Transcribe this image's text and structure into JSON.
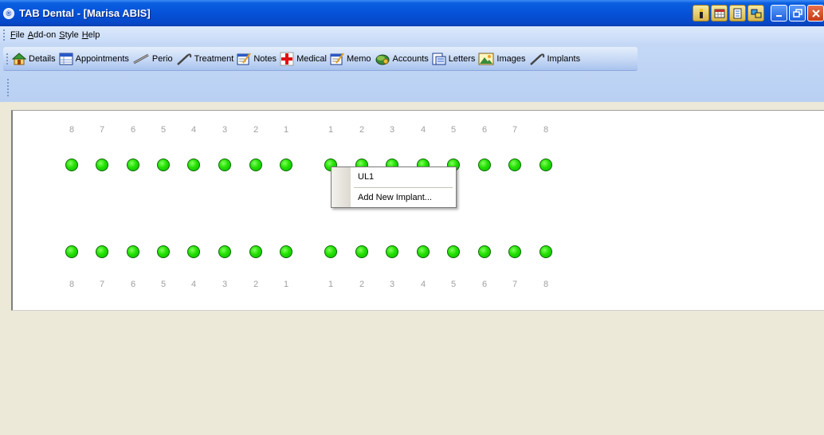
{
  "window": {
    "title": "TAB Dental - [Marisa ABIS]",
    "app_icon_letter": "®"
  },
  "menu": [
    {
      "label": "File",
      "mnemonic": "F"
    },
    {
      "label": "Add-on",
      "mnemonic": "A"
    },
    {
      "label": "Style",
      "mnemonic": "S"
    },
    {
      "label": "Help",
      "mnemonic": "H"
    }
  ],
  "toolbar": [
    {
      "label": "Details",
      "icon": "house-icon"
    },
    {
      "label": "Appointments",
      "icon": "calendar-icon"
    },
    {
      "label": "Perio",
      "icon": "probe-icon"
    },
    {
      "label": "Treatment",
      "icon": "dental-tool-icon"
    },
    {
      "label": "Notes",
      "icon": "notepad-icon"
    },
    {
      "label": "Medical",
      "icon": "red-cross-icon"
    },
    {
      "label": "Memo",
      "icon": "memo-icon"
    },
    {
      "label": "Accounts",
      "icon": "money-icon"
    },
    {
      "label": "Letters",
      "icon": "letter-icon"
    },
    {
      "label": "Images",
      "icon": "image-icon"
    },
    {
      "label": "Implants",
      "icon": "implant-tool-icon"
    }
  ],
  "chart": {
    "upper_numbers": [
      "8",
      "7",
      "6",
      "5",
      "4",
      "3",
      "2",
      "1",
      "1",
      "2",
      "3",
      "4",
      "5",
      "6",
      "7",
      "8"
    ],
    "lower_numbers": [
      "8",
      "7",
      "6",
      "5",
      "4",
      "3",
      "2",
      "1",
      "1",
      "2",
      "3",
      "4",
      "5",
      "6",
      "7",
      "8"
    ],
    "tooth_color": "#22e000"
  },
  "context_menu": {
    "header": "UL1",
    "items": [
      "Add New Implant..."
    ]
  },
  "colors": {
    "titlebar": "#0552d8",
    "menubar": "#c5d9f7",
    "background": "#ece9d8"
  }
}
